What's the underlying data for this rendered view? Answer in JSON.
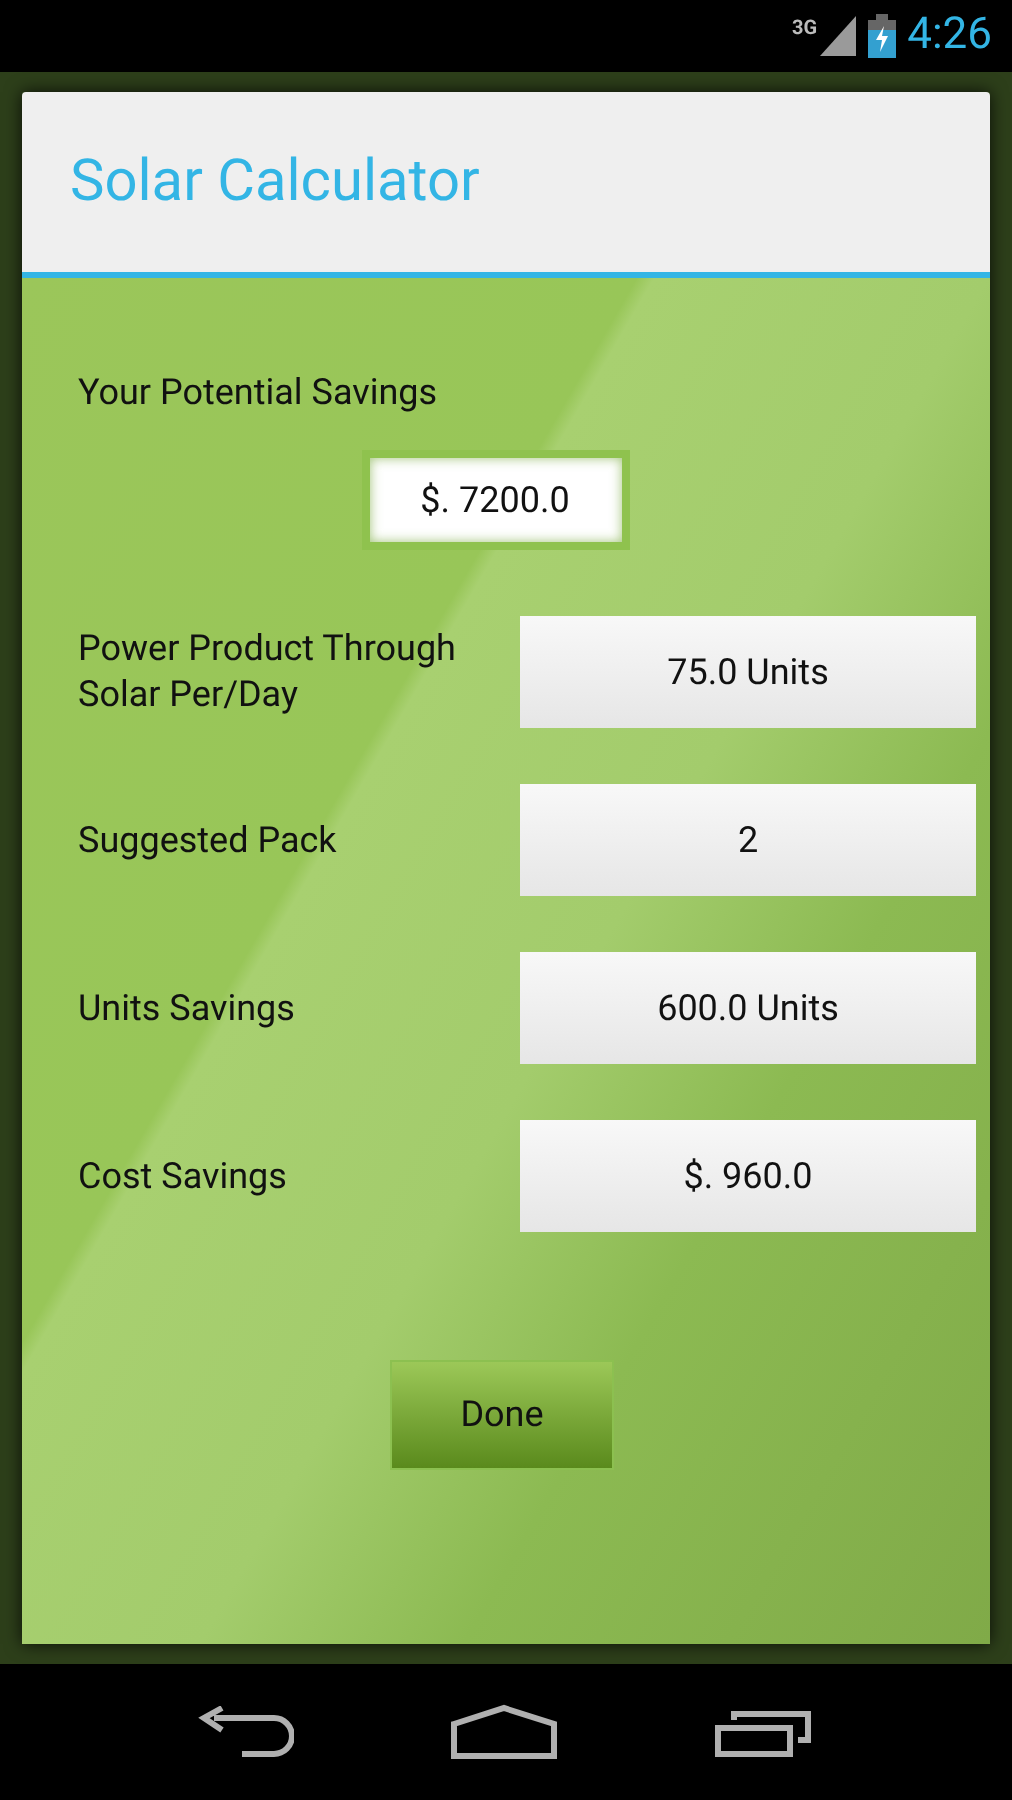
{
  "status_bar": {
    "network": "3G",
    "time": "4:26"
  },
  "dialog": {
    "title": "Solar Calculator",
    "potential_savings": {
      "label": "Your Potential Savings",
      "value": "$. 7200.0"
    },
    "rows": [
      {
        "label": "Power Product Through Solar Per/Day",
        "value": "75.0 Units"
      },
      {
        "label": "Suggested Pack",
        "value": "2"
      },
      {
        "label": "Units Savings",
        "value": "600.0 Units"
      },
      {
        "label": "Cost Savings",
        "value": "$. 960.0"
      }
    ],
    "done_button": "Done"
  }
}
